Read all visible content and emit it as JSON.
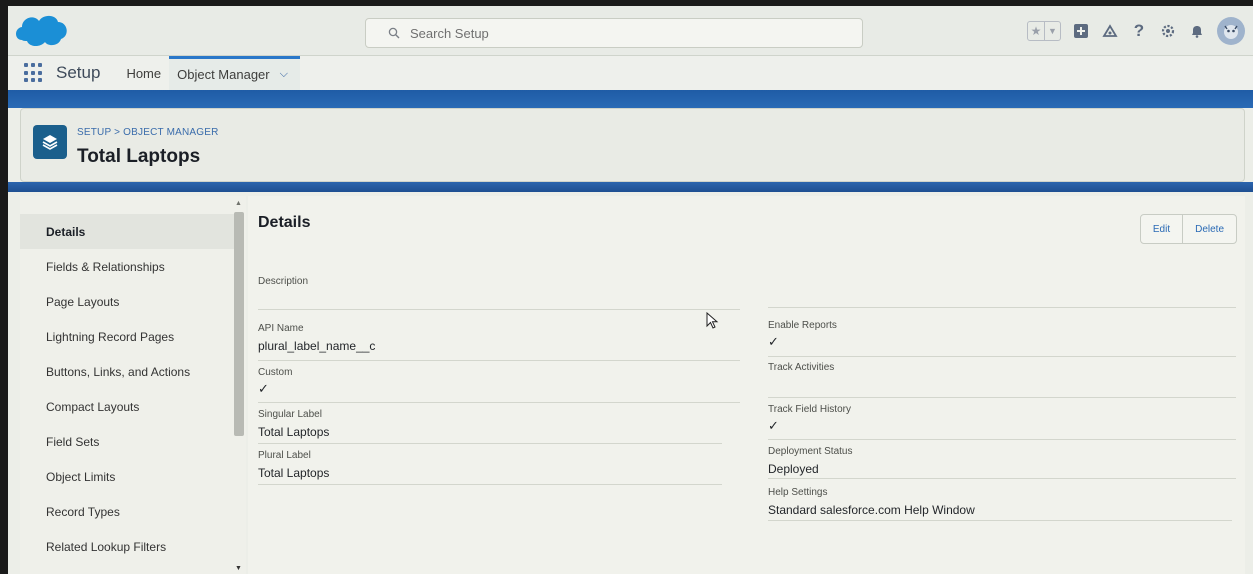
{
  "header": {
    "search_placeholder": "Search Setup",
    "icons": [
      "star-icon",
      "dropdown-icon",
      "plus-icon",
      "trailhead-icon",
      "help-icon",
      "settings-icon",
      "bell-icon",
      "avatar"
    ]
  },
  "nav": {
    "app_name": "Setup",
    "tabs": [
      {
        "label": "Home"
      },
      {
        "label": "Object Manager"
      }
    ]
  },
  "object_header": {
    "breadcrumb": "SETUP > OBJECT MANAGER",
    "title": "Total Laptops"
  },
  "sidebar": {
    "items": [
      {
        "label": "Details"
      },
      {
        "label": "Fields & Relationships"
      },
      {
        "label": "Page Layouts"
      },
      {
        "label": "Lightning Record Pages"
      },
      {
        "label": "Buttons, Links, and Actions"
      },
      {
        "label": "Compact Layouts"
      },
      {
        "label": "Field Sets"
      },
      {
        "label": "Object Limits"
      },
      {
        "label": "Record Types"
      },
      {
        "label": "Related Lookup Filters"
      }
    ]
  },
  "main": {
    "title": "Details",
    "edit_label": "Edit",
    "delete_label": "Delete",
    "left_fields": {
      "description": {
        "label": "Description",
        "value": ""
      },
      "api_name": {
        "label": "API Name",
        "value": "plural_label_name__c"
      },
      "custom": {
        "label": "Custom",
        "checked": true
      },
      "singular_label": {
        "label": "Singular Label",
        "value": "Total Laptops"
      },
      "plural_label": {
        "label": "Plural Label",
        "value": "Total Laptops"
      }
    },
    "right_fields": {
      "enable_reports": {
        "label": "Enable Reports",
        "checked": true
      },
      "track_activities": {
        "label": "Track Activities",
        "checked": false
      },
      "track_field_history": {
        "label": "Track Field History",
        "checked": true
      },
      "deployment_status": {
        "label": "Deployment Status",
        "value": "Deployed"
      },
      "help_settings": {
        "label": "Help Settings",
        "value": "Standard salesforce.com Help Window"
      }
    },
    "check_glyph": "✓"
  },
  "colors": {
    "brand_blue": "#1f5ca6",
    "link_blue": "#2a6ab5",
    "object_icon": "#1b5f8c"
  }
}
